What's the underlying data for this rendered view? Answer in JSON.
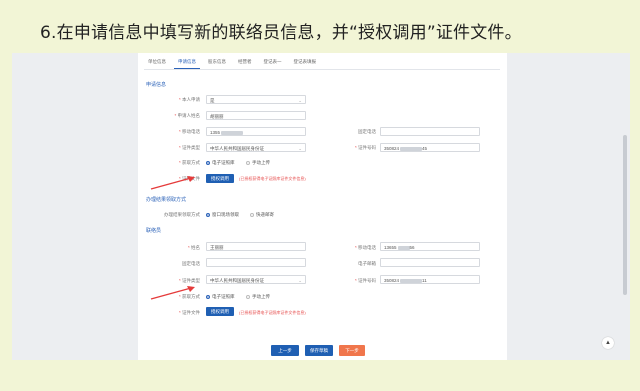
{
  "caption": "6.在申请信息中填写新的联络员信息，并“授权调用”证件文件。",
  "tabs": [
    "单位信息",
    "申请信息",
    "股东信息",
    "经营者",
    "登记表一",
    "登记表填报"
  ],
  "sections": {
    "apply": "申请信息",
    "receive": "办理结果领取方式",
    "liaison": "联络员"
  },
  "apply": {
    "is_self_label": "本人申请",
    "is_self_value": "是",
    "applicant_label": "申请人姓名",
    "applicant_value": "胡丽丽",
    "phone_label": "移动电话",
    "phone_value": "1355",
    "fixed_label": "固定电话",
    "idtype_label": "证件类型",
    "idtype_value": "中华人民共和国居民身份证",
    "idno_label": "证件号码",
    "idno_value": "350824",
    "idno_tail": "45",
    "fetch_label": "获取方式",
    "opt_electronic": "电子证照库",
    "opt_upload": "手动上传",
    "file_label": "证件文件",
    "auth_btn": "授权调用",
    "hint": "(已授权获得电子证照库证件文件信息)"
  },
  "receive": {
    "label": "办理结果领取方式",
    "opt_window": "窗口现场领取",
    "opt_mail": "快递邮寄"
  },
  "liaison": {
    "name_label": "姓名",
    "name_value": "王丽丽",
    "mobile_label": "移动电话",
    "mobile_value": "13655",
    "mobile_tail": "56",
    "fixed_label": "固定电话",
    "email_label": "电子邮箱",
    "idtype_label": "证件类型",
    "idtype_value": "中华人民共和国居民身份证",
    "idno_label": "证件号码",
    "idno_value": "350824",
    "idno_tail": "11",
    "fetch_label": "获取方式",
    "opt_electronic": "电子证照库",
    "opt_upload": "手动上传",
    "file_label": "证件文件",
    "auth_btn": "授权调用",
    "hint": "(已授权获得电子证照库证件文件信息)"
  },
  "nav": {
    "prev": "上一步",
    "save": "保存草稿",
    "next": "下一步"
  },
  "totop_icon": "▲",
  "colors": {
    "primary": "#1f5fb3",
    "next": "#f0764c",
    "arrow": "#e53b3b",
    "background": "#f2f5d6"
  }
}
